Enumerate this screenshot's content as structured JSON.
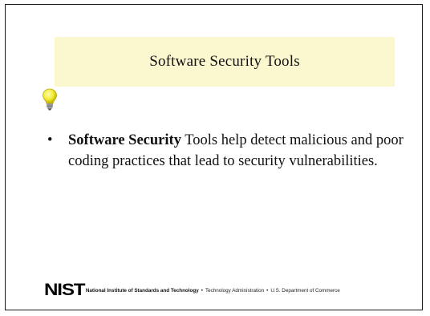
{
  "slide": {
    "title": "Software Security Tools",
    "bullet": {
      "symbol": "•",
      "bold_text": "Software Security",
      "rest_text": " Tools help detect malicious and poor coding practices that lead to security vulnerabilities."
    },
    "footer": {
      "logo": "NIST",
      "org_name": "National Institute of Standards and Technology",
      "separator": "•",
      "admin": "Technology Administration",
      "dept": "U.S. Department of Commerce"
    },
    "icons": {
      "bulb": "lightbulb-icon"
    },
    "colors": {
      "title_background": "#fbf8cf",
      "bulb_glass": "#f2ec3a",
      "border": "#1a1a1a"
    }
  }
}
